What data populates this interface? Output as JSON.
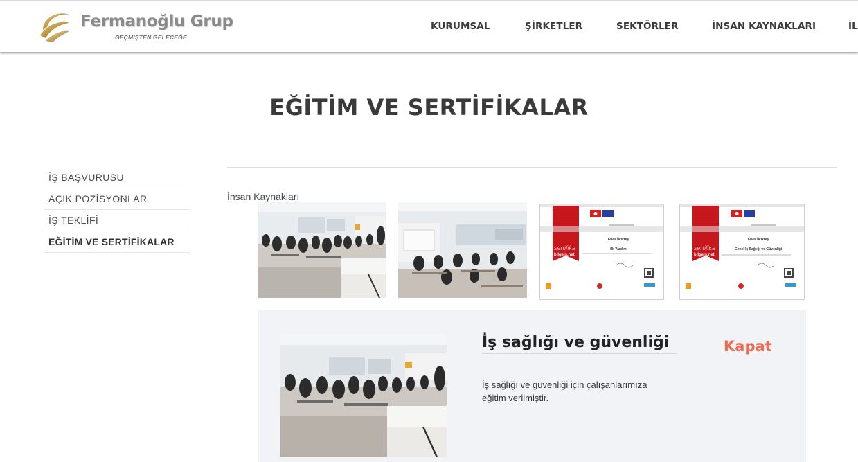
{
  "header": {
    "brand_name": "Fermanoğlu Grup",
    "brand_tagline": "GEÇMİŞTEN GELECEĞE",
    "nav": [
      "KURUMSAL",
      "ŞİRKETLER",
      "SEKTÖRLER",
      "İNSAN KAYNAKLARI",
      "İL"
    ]
  },
  "page": {
    "title": "EĞİTİM VE SERTİFİKALAR"
  },
  "sidebar": {
    "items": [
      "İŞ BAŞVURUSU",
      "AÇIK POZİSYONLAR",
      "İŞ TEKLİFİ",
      "EĞİTİM VE SERTİFİKALAR"
    ],
    "active": "EĞİTİM VE SERTİFİKALAR"
  },
  "main": {
    "breadcrumb": "İnsan Kaynakları",
    "certificates": [
      {
        "brand": "sertifika",
        "site": "bilgeis.net",
        "name": "Enes İlçikteş",
        "course": "İlk Yardım"
      },
      {
        "brand": "sertifika",
        "site": "bilgeis.net",
        "name": "Enes İlçikteş",
        "course": "Genel İş Sağlığı ve Güvenliği"
      }
    ]
  },
  "detail": {
    "title": "İş sağlığı ve güvenliği",
    "close_label": "Kapat",
    "description": "İş sağlığı ve güvenliği için çalışanlarımıza eğitim verilmiştir."
  },
  "colors": {
    "accent": "#ef6a4f",
    "panel_bg": "#f1f3f6",
    "cert_red": "#c8161d",
    "logo_gold": "#c9a24a"
  }
}
